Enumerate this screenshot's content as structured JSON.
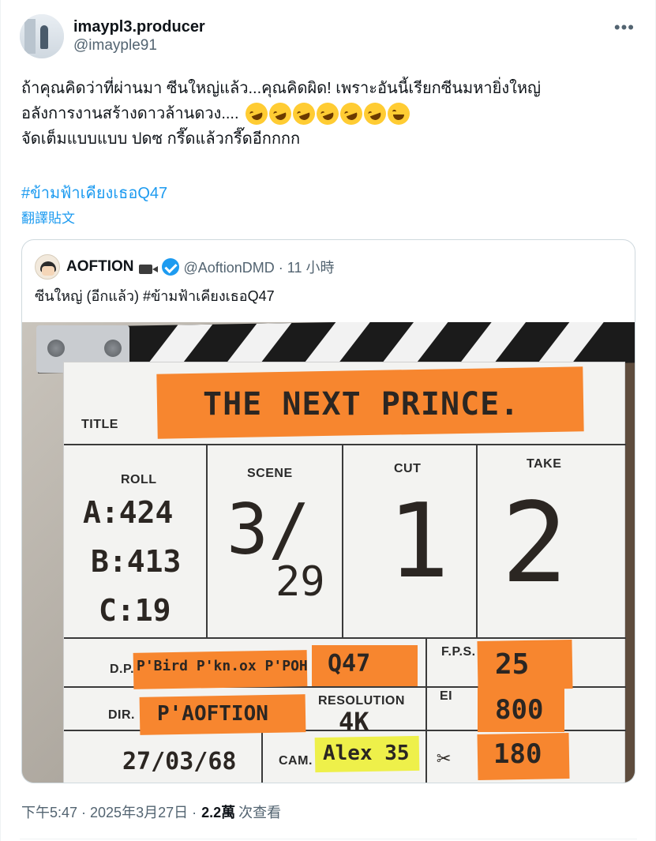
{
  "author": {
    "display_name": "imaypl3.producer",
    "handle": "@imayple91"
  },
  "tweet": {
    "line1": "ถ้าคุณคิดว่าที่ผ่านมา ซีนใหญ่แล้ว...คุณคิดผิด! เพราะอันนี้เรียกซีนมหายิ่งใหญ่",
    "line2": "อลังการงานสร้างดาวล้านดวง....",
    "line3": "จัดเต็มแบบแบบ ปดซ กรี๊ดแล้วกรี๊ดอีกกกก",
    "hashtag": "#ข้ามฟ้าเคียงเธอQ47",
    "translate": "翻譯貼文",
    "emoji_icons": [
      "rolling-on-floor-laughing-icon",
      "rolling-on-floor-laughing-icon",
      "rolling-on-floor-laughing-icon",
      "rolling-on-floor-laughing-icon",
      "rolling-on-floor-laughing-icon",
      "rolling-on-floor-laughing-icon",
      "grinning-squinting-face-icon"
    ]
  },
  "quote": {
    "display_name": "AOFTION",
    "handle_time": "@AoftionDMD · 11 小時",
    "text": "ซีนใหญ่ (อีกแล้ว) #ข้ามฟ้าเคียงเธอQ47",
    "photo": {
      "labels": {
        "title": "TITLE",
        "roll": "ROLL",
        "scene": "SCENE",
        "cut": "CUT",
        "take": "TAKE",
        "dp": "D.P.",
        "fps": "F.P.S.",
        "dir": "DIR.",
        "resolution": "RESOLUTION",
        "ei": "EI",
        "cam": "CAM."
      },
      "handwriting": {
        "title": "THE NEXT PRINCE.",
        "roll_a": "A:424",
        "roll_b": "B:413",
        "roll_c": "C:19",
        "scene_top": "3/",
        "scene_bottom": "29",
        "cut": "1",
        "take": "2",
        "dp": "P'Bird P'kn.ox P'POH",
        "q": "Q47",
        "fps": "25",
        "dir": "P'AOFTION",
        "res": "4K",
        "ei": "800",
        "date": "27/03/68",
        "cam": "Alex 35",
        "angle": "180"
      },
      "colors": {
        "tape": "#f7862f",
        "tape_yellow": "#eef04a"
      }
    }
  },
  "meta": {
    "timestamp": "下午5:47 · 2025年3月27日 ·",
    "views": "2.2萬",
    "views_label": "次查看"
  },
  "colors": {
    "link": "#1d9bf0",
    "muted": "#536471",
    "text": "#0f1419"
  }
}
